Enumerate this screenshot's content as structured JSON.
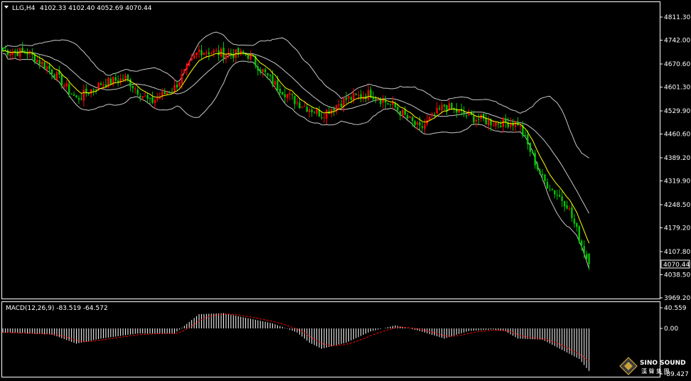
{
  "header": {
    "symbol_label": "LLG,H4",
    "ohlc_label": "4102.33 4102.40 4052.69 4070.44"
  },
  "price_axis": {
    "ticks": [
      "4811.30",
      "4742.00",
      "4670.60",
      "4601.30",
      "4529.90",
      "4460.60",
      "4389.20",
      "4319.90",
      "4248.50",
      "4179.20",
      "4107.80",
      "4038.50",
      "3969.20"
    ],
    "current_price_label": "4070.44"
  },
  "macd": {
    "label": "MACD(12,26,9) -83.519 -64.572",
    "ticks": [
      "40.559",
      "0.00",
      "-89.427"
    ]
  },
  "watermark": {
    "brand": "SINO SOUND",
    "chinese": "漢 聲 集 團"
  },
  "colors": {
    "background": "#000000",
    "bull_candle": "#ff0000",
    "bear_candle": "#00c800",
    "ma_line": "#ffff00",
    "bollinger": "#c8c8c8",
    "macd_hist": "#ffffff",
    "macd_signal": "#ff0000",
    "axis_text": "#ffffff"
  },
  "chart_data": [
    {
      "type": "candlestick",
      "title": "LLG,H4",
      "ylim": [
        3950,
        4830
      ],
      "indicators": [
        "Bollinger Bands (upper/middle/lower)",
        "Moving Average"
      ],
      "trend_points": {
        "x": [
          0,
          10,
          20,
          30,
          40,
          50,
          60,
          70,
          80,
          90,
          100,
          110,
          120,
          130,
          140,
          150,
          160,
          170,
          180,
          190,
          200,
          210,
          220,
          230,
          239
        ],
        "close": [
          4710,
          4705,
          4650,
          4565,
          4612,
          4628,
          4555,
          4600,
          4712,
          4702,
          4698,
          4615,
          4555,
          4520,
          4565,
          4582,
          4540,
          4475,
          4545,
          4512,
          4495,
          4495,
          4325,
          4250,
          4070
        ]
      },
      "last_bar": {
        "open": 4102.33,
        "high": 4102.4,
        "low": 4052.69,
        "close": 4070.44
      }
    },
    {
      "type": "bar",
      "title": "MACD(12,26,9)",
      "ylim": [
        -89.427,
        40.559
      ],
      "macd_value": -83.519,
      "signal_value": -64.572,
      "trend_points": {
        "x": [
          0,
          20,
          30,
          40,
          55,
          70,
          80,
          90,
          100,
          110,
          120,
          125,
          130,
          140,
          150,
          160,
          170,
          180,
          190,
          200,
          205,
          210,
          220,
          235,
          239
        ],
        "hist": [
          -8,
          -12,
          -30,
          -20,
          -10,
          -10,
          28,
          30,
          20,
          10,
          -8,
          -28,
          -40,
          -28,
          -6,
          6,
          -5,
          -20,
          -5,
          -2,
          -6,
          -20,
          -22,
          -60,
          -84
        ]
      }
    }
  ]
}
